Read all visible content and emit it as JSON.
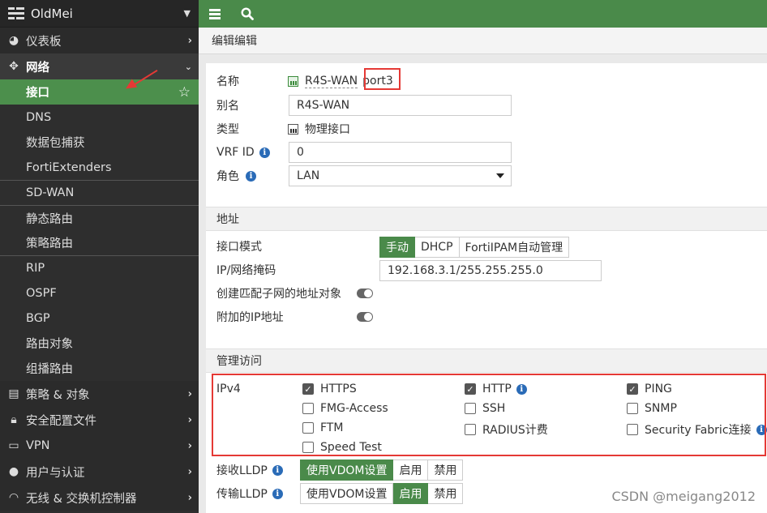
{
  "brand": {
    "name": "OldMei"
  },
  "sidebar": {
    "top": {
      "label": "仪表板"
    },
    "network": {
      "label": "网络"
    },
    "network_items": [
      "接口",
      "DNS",
      "数据包捕获",
      "FortiExtenders",
      "SD-WAN",
      "静态路由",
      "策略路由",
      "RIP",
      "OSPF",
      "BGP",
      "路由对象",
      "组播路由"
    ],
    "sections": [
      "策略 & 对象",
      "安全配置文件",
      "VPN",
      "用户与认证",
      "无线 & 交换机控制器"
    ]
  },
  "page": {
    "title": "编辑编辑"
  },
  "form": {
    "name_label": "名称",
    "name_value": "R4S-WAN",
    "name_port": "port3",
    "alias_label": "别名",
    "alias_value": "R4S-WAN",
    "type_label": "类型",
    "type_value": "物理接口",
    "vrf_label": "VRF ID",
    "vrf_value": "0",
    "role_label": "角色",
    "role_value": "LAN"
  },
  "address": {
    "section": "地址",
    "mode_label": "接口模式",
    "modes": [
      "手动",
      "DHCP",
      "FortiIPAM自动管理"
    ],
    "ip_label": "IP/网络掩码",
    "ip_value": "192.168.3.1/255.255.255.0",
    "create_subnet_label": "创建匹配子网的地址对象",
    "secondary_ip_label": "附加的IP地址"
  },
  "admin": {
    "section": "管理访问",
    "ipv4_label": "IPv4",
    "options": [
      "HTTPS",
      "HTTP",
      "PING",
      "FMG-Access",
      "SSH",
      "SNMP",
      "FTM",
      "RADIUS计费",
      "Security Fabric连接",
      "Speed Test"
    ],
    "checked": [
      "HTTPS",
      "HTTP",
      "PING"
    ],
    "lldp_rx_label": "接收LLDP",
    "lldp_tx_label": "传输LLDP",
    "lldp_options": [
      "使用VDOM设置",
      "启用",
      "禁用"
    ],
    "lldp_rx_selected": "使用VDOM设置",
    "lldp_tx_selected": "启用"
  },
  "watermark": "CSDN @meigang2012",
  "colors": {
    "accent": "#4a8a4a",
    "highlight": "#e53935",
    "sidebar": "#2e2e2e"
  }
}
